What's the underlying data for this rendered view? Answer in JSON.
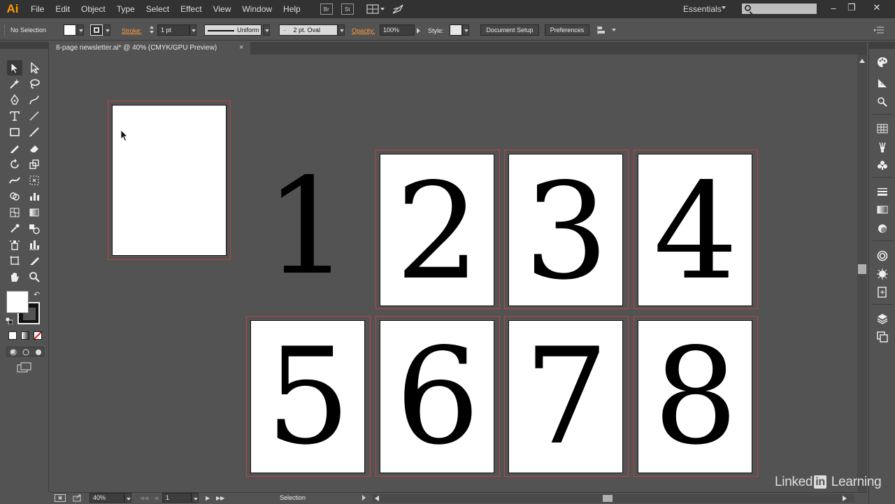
{
  "app": {
    "logo": "Ai"
  },
  "menu": [
    "File",
    "Edit",
    "Object",
    "Type",
    "Select",
    "Effect",
    "View",
    "Window",
    "Help"
  ],
  "menubar_icons": {
    "bridge": "Br",
    "stock": "St"
  },
  "workspace": "Essentials",
  "window_controls": {
    "minimize": "–",
    "restore": "❐",
    "close": "✕"
  },
  "control_bar": {
    "selection_status": "No Selection",
    "stroke_label": "Stroke:",
    "stroke_weight": "1 pt",
    "stroke_profile": "Uniform",
    "brush": "2 pt. Oval",
    "brush_dot": "·",
    "opacity_label": "Opacity:",
    "opacity_value": "100%",
    "style_label": "Style:",
    "document_setup": "Document Setup",
    "preferences": "Preferences"
  },
  "document": {
    "tab_title": "8-page newsletter.ai* @ 40% (CMYK/GPU Preview)",
    "tab_close": "×"
  },
  "artboards": {
    "label_one": "1",
    "pages": [
      "2",
      "3",
      "4",
      "5",
      "6",
      "7",
      "8"
    ]
  },
  "status_bar": {
    "zoom": "40%",
    "artboard_number": "1",
    "tool_status": "Selection"
  },
  "watermark": {
    "pre": "Linked",
    "box": "in",
    "post": " Learning"
  },
  "colors": {
    "accent_orange": "#ff9a00",
    "artboard_outline": "#b8453f",
    "canvas": "#535353"
  }
}
